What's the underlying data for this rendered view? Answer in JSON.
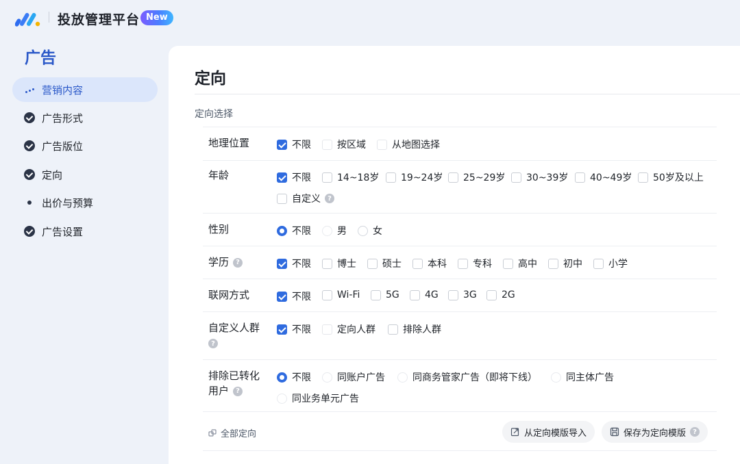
{
  "header": {
    "app_title": "投放管理平台",
    "badge": "New"
  },
  "sidebar": {
    "title": "广告",
    "items": [
      {
        "label": "营销内容",
        "icon": "progress-dots-icon",
        "state": "active"
      },
      {
        "label": "广告形式",
        "icon": "check-circle-icon",
        "state": "done"
      },
      {
        "label": "广告版位",
        "icon": "check-circle-icon",
        "state": "done"
      },
      {
        "label": "定向",
        "icon": "check-circle-icon",
        "state": "done"
      },
      {
        "label": "出价与预算",
        "icon": "dot-icon",
        "state": "pending"
      },
      {
        "label": "广告设置",
        "icon": "check-circle-icon",
        "state": "done"
      }
    ]
  },
  "main": {
    "title": "定向",
    "section_label": "定向选择",
    "rows": {
      "geo": {
        "label": "地理位置",
        "options": [
          {
            "label": "不限",
            "checked": true
          },
          {
            "label": "按区域",
            "checked": false
          },
          {
            "label": "从地图选择",
            "checked": false
          }
        ]
      },
      "age": {
        "label": "年龄",
        "options": [
          {
            "label": "不限",
            "checked": true
          },
          {
            "label": "14~18岁",
            "checked": false
          },
          {
            "label": "19~24岁",
            "checked": false
          },
          {
            "label": "25~29岁",
            "checked": false
          },
          {
            "label": "30~39岁",
            "checked": false
          },
          {
            "label": "40~49岁",
            "checked": false
          },
          {
            "label": "50岁及以上",
            "checked": false
          },
          {
            "label": "自定义",
            "checked": false
          }
        ]
      },
      "gender": {
        "label": "性别",
        "options": [
          {
            "label": "不限",
            "selected": true
          },
          {
            "label": "男",
            "selected": false
          },
          {
            "label": "女",
            "selected": false
          }
        ]
      },
      "education": {
        "label": "学历",
        "options": [
          {
            "label": "不限",
            "checked": true
          },
          {
            "label": "博士",
            "checked": false
          },
          {
            "label": "硕士",
            "checked": false
          },
          {
            "label": "本科",
            "checked": false
          },
          {
            "label": "专科",
            "checked": false
          },
          {
            "label": "高中",
            "checked": false
          },
          {
            "label": "初中",
            "checked": false
          },
          {
            "label": "小学",
            "checked": false
          }
        ]
      },
      "network": {
        "label": "联网方式",
        "options": [
          {
            "label": "不限",
            "checked": true
          },
          {
            "label": "Wi-Fi",
            "checked": false
          },
          {
            "label": "5G",
            "checked": false
          },
          {
            "label": "4G",
            "checked": false
          },
          {
            "label": "3G",
            "checked": false
          },
          {
            "label": "2G",
            "checked": false
          }
        ]
      },
      "custom_audience": {
        "label": "自定义人群",
        "options": [
          {
            "label": "不限",
            "checked": true
          },
          {
            "label": "定向人群",
            "checked": false
          },
          {
            "label": "排除人群",
            "checked": false
          }
        ]
      },
      "exclude_converted": {
        "label_line1": "排除已转化",
        "label_line2": "用户",
        "options": [
          {
            "label": "不限",
            "selected": true
          },
          {
            "label": "同账户广告",
            "selected": false
          },
          {
            "label": "同商务管家广告（即将下线）",
            "selected": false
          },
          {
            "label": "同主体广告",
            "selected": false
          },
          {
            "label": "同业务单元广告",
            "selected": false
          }
        ]
      }
    },
    "footer": {
      "all_targeting": "全部定向",
      "import_template": "从定向模版导入",
      "save_template": "保存为定向模版"
    }
  },
  "colors": {
    "accent": "#2f6bdf",
    "sidebar_active_bg": "#dbe6fb",
    "page_bg": "#eef2f9"
  }
}
